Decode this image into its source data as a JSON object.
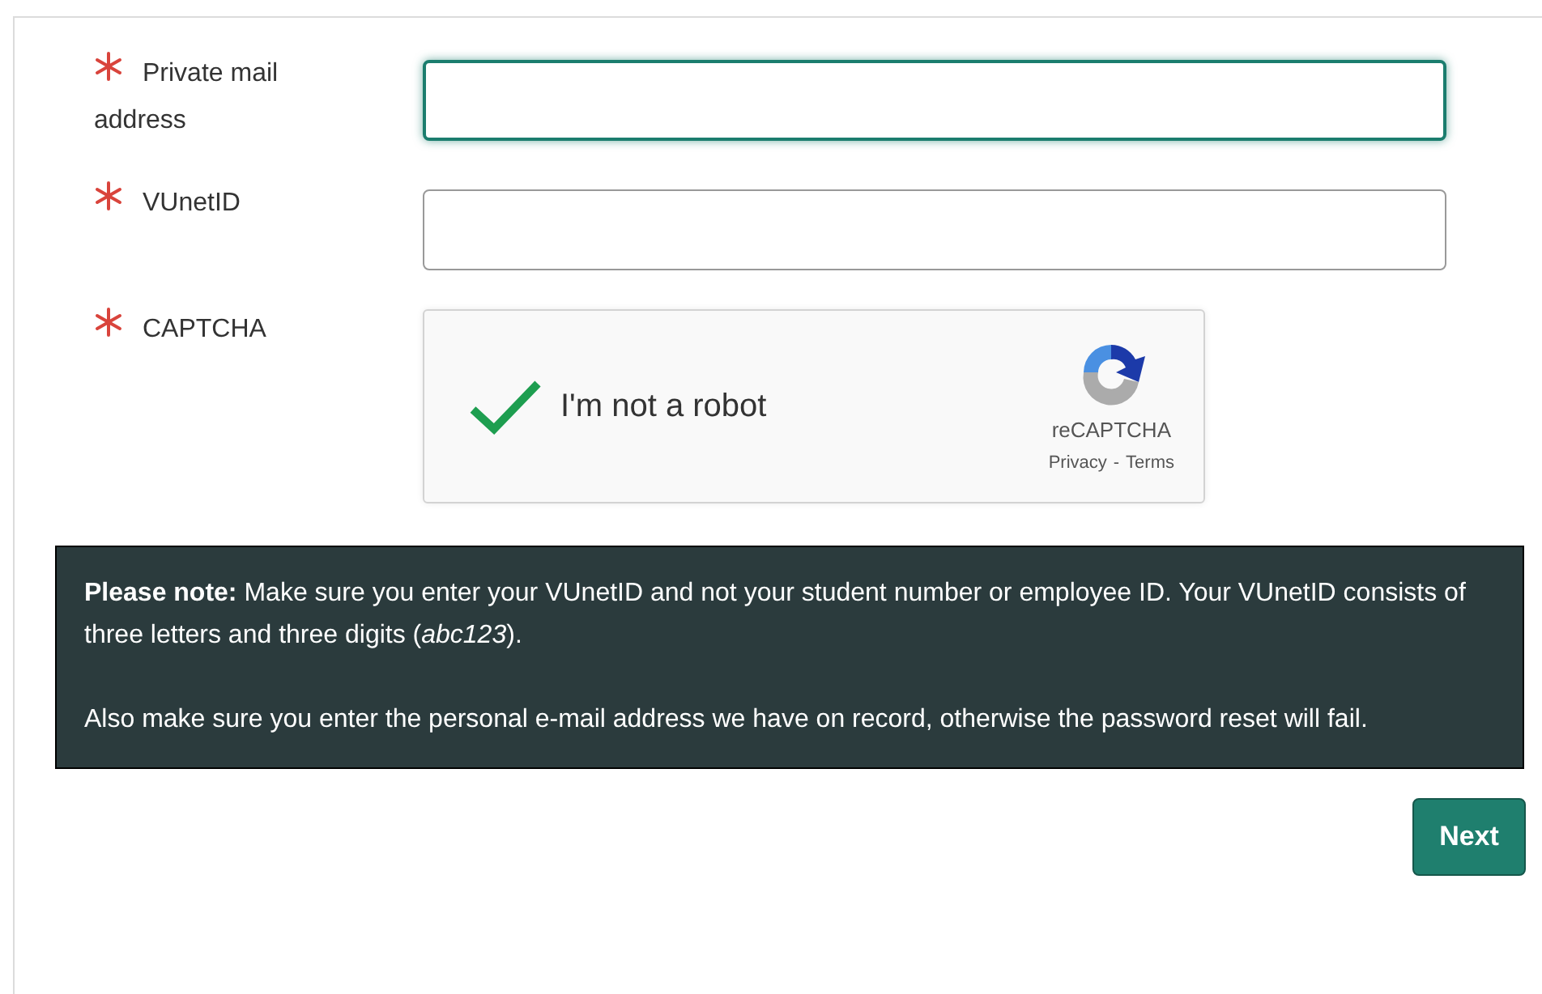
{
  "fields": [
    {
      "label": "Private mail address",
      "required": true,
      "focused": true
    },
    {
      "label": "VUnetID",
      "required": true,
      "focused": false
    }
  ],
  "captcha": {
    "label": "CAPTCHA",
    "required": true,
    "checked": true,
    "text": "I'm not a robot",
    "brand": "reCAPTCHA",
    "privacy": "Privacy",
    "separator": "-",
    "terms": "Terms"
  },
  "note": [
    "**Please note:** Make sure you enter your VUnetID and not your student number or employee ID. Your VUnetID consists of three letters and three digits (*abc123*).",
    "Also make sure you enter the personal e-mail address we have on record, otherwise the password reset will fail."
  ],
  "button": "Next"
}
